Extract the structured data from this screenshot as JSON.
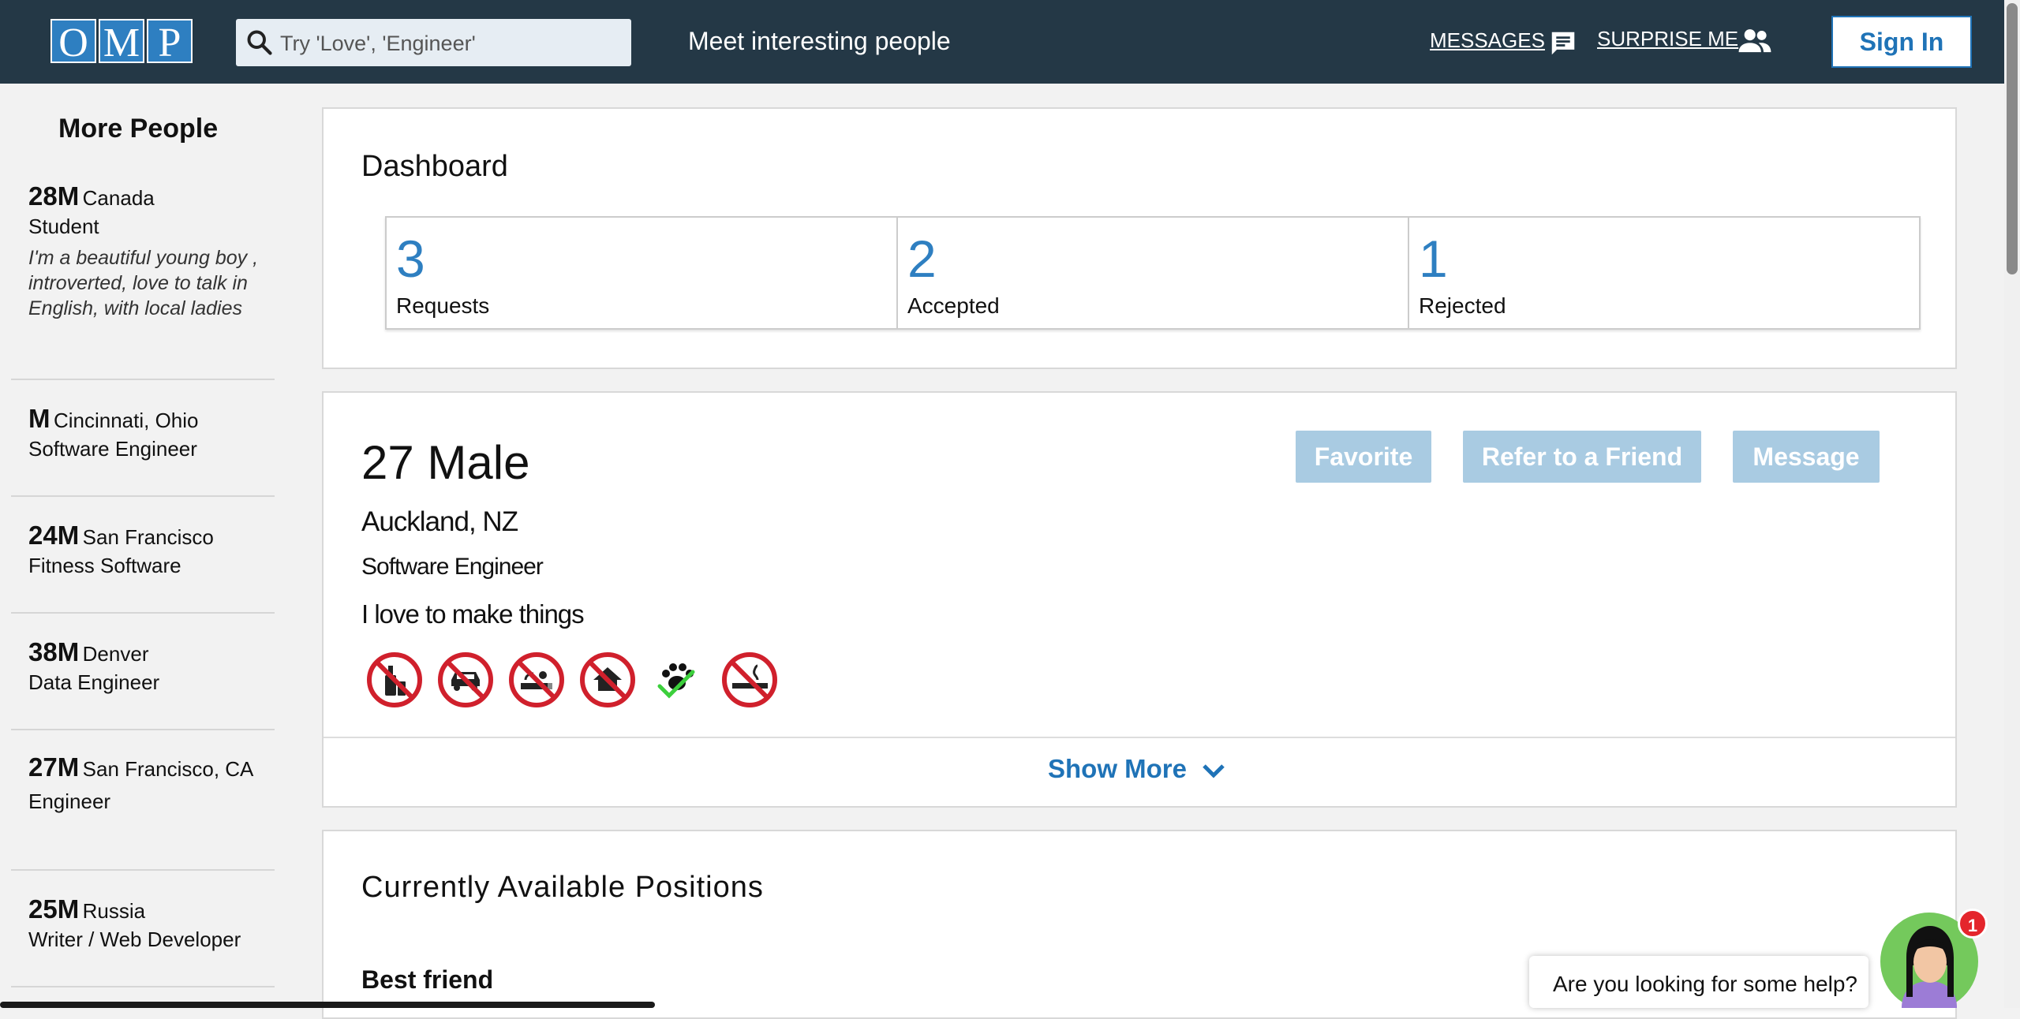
{
  "header": {
    "logo_letters": [
      "O",
      "M",
      "P"
    ],
    "search_placeholder": "Try 'Love', 'Engineer'",
    "tagline": "Meet interesting people",
    "messages_label": "MESSAGES",
    "surprise_label": "SURPRISE ME",
    "signin_label": "Sign In",
    "bar_color": "#243846"
  },
  "sidebar": {
    "title": "More People",
    "people": [
      {
        "age": "28M",
        "location": "Canada",
        "job": "Student",
        "bio": "I'm a beautiful young boy , introverted, love to talk in English, with local ladies"
      },
      {
        "age": "M",
        "location": "Cincinnati, Ohio",
        "job": "Software Engineer",
        "bio": ""
      },
      {
        "age": "24M",
        "location": "San Francisco",
        "job": "Fitness Software",
        "bio": ""
      },
      {
        "age": "38M",
        "location": "Denver",
        "job": "Data Engineer",
        "bio": ""
      },
      {
        "age": "27M",
        "location": "San Francisco, CA",
        "job": "Engineer",
        "bio": ""
      },
      {
        "age": "25M",
        "location": "Russia",
        "job": "Writer / Web Developer",
        "bio": ""
      }
    ]
  },
  "dashboard": {
    "title": "Dashboard",
    "stats": [
      {
        "value": "3",
        "label": "Requests"
      },
      {
        "value": "2",
        "label": "Accepted"
      },
      {
        "value": "1",
        "label": "Rejected"
      }
    ]
  },
  "profile": {
    "age_gender": "27 Male",
    "location": "Auckland, NZ",
    "job": "Software Engineer",
    "bio": "I love to make things",
    "buttons": {
      "favorite": "Favorite",
      "refer": "Refer to a Friend",
      "message": "Message"
    },
    "habit_icons": [
      "no-drinking-icon",
      "no-car-icon",
      "no-drugs-icon",
      "no-house-icon",
      "pets-ok-icon",
      "no-smoking-icon"
    ],
    "show_more": "Show More"
  },
  "positions": {
    "title": "Currently Available Positions",
    "first": "Best friend"
  },
  "help": {
    "text": "Are you looking for some help?",
    "badge": "1"
  }
}
